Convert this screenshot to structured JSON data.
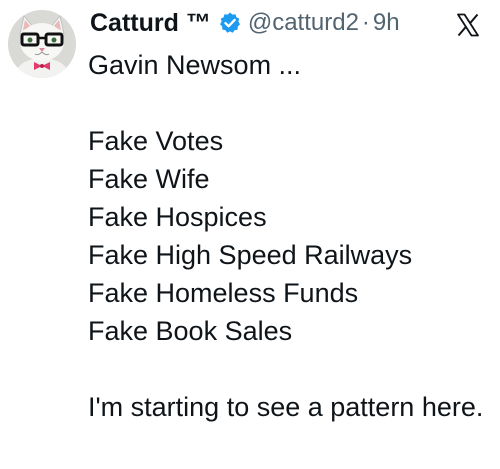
{
  "tweet": {
    "display_name": "Catturd ™",
    "verified_icon": "verified-badge-icon",
    "handle": "@catturd2",
    "separator": "·",
    "time": "9h",
    "platform_icon": "x-logo-icon",
    "avatar_icon": "cat-with-glasses-avatar",
    "colors": {
      "verified": "#1d9bf0",
      "text": "#0f1419",
      "secondary": "#536471"
    },
    "text_lines": {
      "intro": "Gavin Newsom ...",
      "list": [
        "Fake Votes",
        "Fake Wife",
        "Fake Hospices",
        "Fake High Speed Railways",
        "Fake Homeless Funds",
        "Fake Book Sales"
      ],
      "closing": "I'm starting to see a pattern here."
    }
  }
}
